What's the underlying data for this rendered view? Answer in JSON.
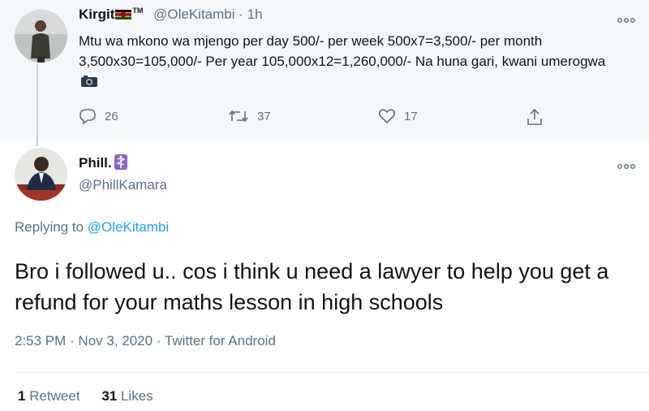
{
  "parent_tweet": {
    "display_name": "Kirgit",
    "tm": "TM",
    "handle": "@OleKitambi",
    "time": "· 1h",
    "text": "Mtu wa mkono wa mjengo per day 500/- per week 500x7=3,500/- per month 3,500x30=105,000/- Per year 105,000x12=1,260,000/- Na huna gari, kwani umerogwa",
    "flag_icon": "kenya-flag-icon",
    "emoji_icon": "camera-icon",
    "actions": {
      "replies": "26",
      "retweets": "37",
      "likes": "17"
    }
  },
  "main_tweet": {
    "display_name": "Phill.",
    "handle": "@PhillKamara",
    "badge_icon": "medical-symbol-icon",
    "replying_prefix": "Replying to",
    "replying_handle": "@OleKitambi",
    "text": "Bro i followed u.. cos i think u need a lawyer to help you get a refund for your maths lesson in high schools",
    "timestamp": "2:53 PM · Nov 3, 2020 · Twitter for Android",
    "retweet_count": "1",
    "retweet_label": "Retweet",
    "like_count": "31",
    "like_label": "Likes"
  },
  "colors": {
    "accent": "#1da1f2",
    "secondary_text": "#5b7083",
    "parent_bg": "#f5f8fa",
    "badge": "#8a65c9"
  }
}
